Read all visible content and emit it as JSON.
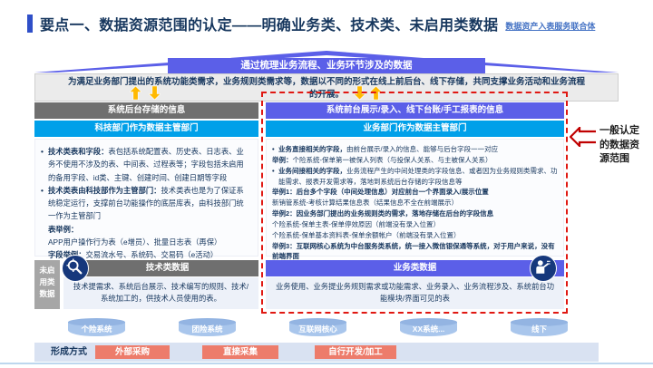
{
  "colors": {
    "title_navy": "#17375E",
    "accent_blue": "#2F4FC8",
    "link_blue": "#4472C4",
    "banner_violet": "#5B5FE8",
    "cyan_header": "#00A0E9",
    "gray_header": "#6F6F6F",
    "dashed_red": "#E01812",
    "yellow_arrow": "#FFB900",
    "icon_navy": "#16387C",
    "cylinder_blue": "#A9C6EC",
    "method_salmon": "#ED7C6B",
    "strip_blue": "#D9E2F2"
  },
  "header": {
    "title": "要点一、数据资源范围的认定——明确业务类、技术类、未启用类数据",
    "link": "数据资产入表服务联合体"
  },
  "banner": {
    "text": "通过梳理业务流程、业务环节涉及的数据"
  },
  "intro": {
    "text": "为满足业务部门提出的系统功能类需求，业务规则类需求等，数据以不同的形式在线上前后台、线下存储，共同支撑业务活动和业务流程的开展。"
  },
  "left_panel": {
    "header1": "系统后台存储的信息",
    "header2": "科技部门作为数据主管部门",
    "bullets": [
      {
        "lead": "技术类表和字段：",
        "text": "表包括系统配置表、历史表、日志表、业务不使用不涉及的表、中间表、过程表等；字段包括未启用的备用字段、id类、主键、创建时间、创建日期等字段"
      },
      {
        "lead": "技术类表由科技部作为主管部门：",
        "text": "技术类表也是为了保证系统稳定运行，支撑前台功能操作的底层库表，由科技部门统一作为主管部门"
      }
    ],
    "examples": [
      {
        "lead": "表举例：",
        "text": "APP用户操作行为表（e增员）、批量日志表（再保）"
      },
      {
        "lead": "字段举例：",
        "text": "交易流水号、系统码、交易码（e活动）"
      }
    ]
  },
  "right_panel": {
    "header1": "系统前台展示/录入、线下台账/手工报表的信息",
    "header2": "业务部门作为数据主管部门",
    "lines": [
      {
        "lead": "业务直接相关的字段，",
        "text": "由前台展示/录入的信息、能够与后台字段一一对应"
      },
      {
        "lead": "举例：",
        "text": "个险系统-保单第一被保人列表（与投保人关系、与主被保人关系）"
      },
      {
        "lead": "业务间接相关的字段，",
        "text": "业务流程产生的中间处理类的字段信息、或者因为业务规则类需求、功能需求、报表开发需求等，落地到系统后台存储的字段信息等"
      },
      {
        "lead": "",
        "text": "举例1：后台多个字段（中间处理信息）对应前台一个界面录入/展示位置"
      },
      {
        "lead": "",
        "text": "新销管系统-考核计算结果信息表（结果信息不全在前端展示）"
      },
      {
        "lead": "",
        "text": "举例2：因业务部门提出的业务规则类的需求，落地存储在后台的字段信息"
      },
      {
        "lead": "",
        "text": "个险系统-保单主表-保单停效原因（前端没有录入位置）"
      },
      {
        "lead": "",
        "text": "个险系统-保单基本资料表-保单余额帐户（前端没有录入位置）"
      },
      {
        "lead": "",
        "text": "举例3：互联网核心系统为中台服务类系统，统一接入微信银保通等系统，对于用户来说，没有前端界面"
      }
    ]
  },
  "annotation": {
    "text": "一般认定的数据资源范围"
  },
  "bottom": {
    "unused_label": "未启用类数据",
    "tech": {
      "title": "技术类数据",
      "icon": "magnifier-gear-icon",
      "desc": "技术提需求、系统后台展示、技术编写的规则、技术/系统加工的，供技术人员使用的表。"
    },
    "biz": {
      "title": "业务类数据",
      "icon": "person-icon",
      "desc": "业务使用、业务提业务规则需求或功能需求、业务录入、业务流程涉及、系统前台功能模块/界面可见的表"
    }
  },
  "systems": [
    "个险系统",
    "团险系统",
    "互联网核心",
    "XX系统...",
    "线下"
  ],
  "formation": {
    "label": "形成方式",
    "methods": [
      "外部采购",
      "直接采集",
      "自行开发/加工"
    ]
  }
}
